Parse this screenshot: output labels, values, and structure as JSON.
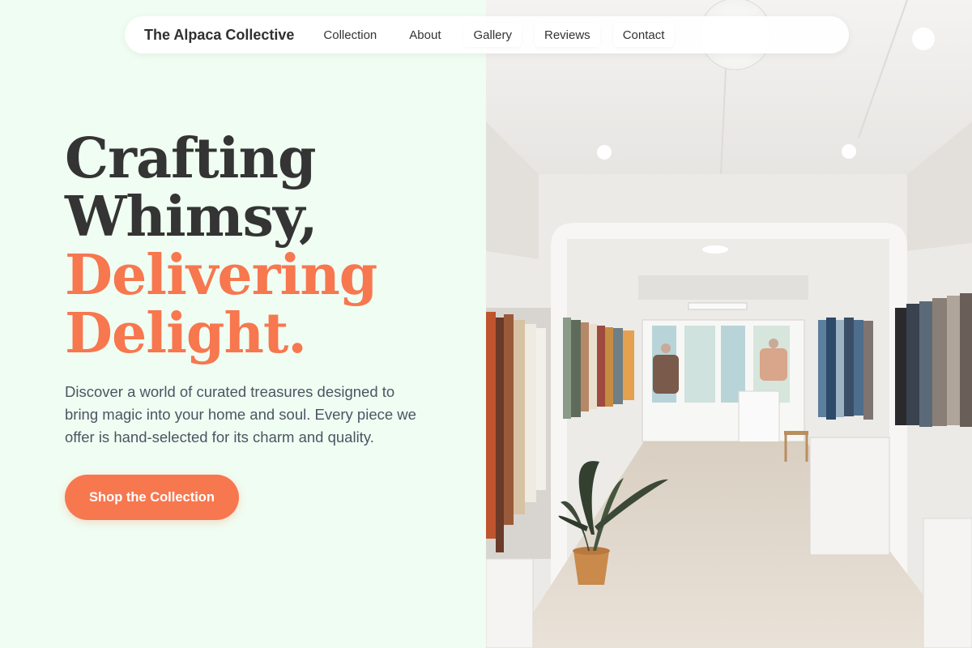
{
  "nav": {
    "brand": "The Alpaca Collective",
    "links": [
      {
        "label": "Collection"
      },
      {
        "label": "About"
      },
      {
        "label": "Gallery"
      },
      {
        "label": "Reviews"
      },
      {
        "label": "Contact"
      }
    ]
  },
  "hero": {
    "headline_line1": "Crafting",
    "headline_line2": "Whimsy,",
    "headline_line3": "Delivering",
    "headline_line4": "Delight.",
    "description": "Discover a world of curated treasures designed to bring magic into your home and soul. Every piece we offer is hand-selected for its charm and quality.",
    "cta_label": "Shop the Collection"
  },
  "colors": {
    "accent": "#f7774f",
    "background": "#f0fdf2",
    "text_dark": "#333433",
    "text_body": "#4b5563"
  },
  "image": {
    "subject": "store-interior-photo"
  }
}
